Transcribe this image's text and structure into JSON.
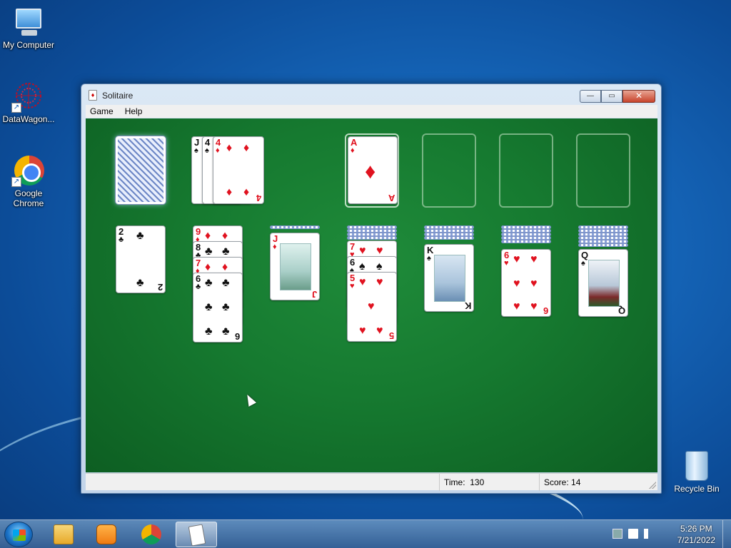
{
  "desktop": {
    "icons": [
      {
        "label": "My Computer",
        "icon": "computer-icon"
      },
      {
        "label": "DataWagon...",
        "icon": "datawagon-icon"
      },
      {
        "label": "Google Chrome",
        "icon": "chrome-icon"
      }
    ],
    "recycle_bin": {
      "label": "Recycle Bin",
      "icon": "recycle-bin-icon"
    }
  },
  "window": {
    "title": "Solitaire",
    "menu": [
      "Game",
      "Help"
    ],
    "controls": {
      "minimize": "—",
      "maximize": "▭",
      "close": "✕"
    }
  },
  "game": {
    "stock": {
      "face_down": true
    },
    "waste": [
      {
        "rank": "J",
        "suit": "♠"
      },
      {
        "rank": "4",
        "suit": "♠"
      },
      {
        "rank": "4",
        "suit": "♦"
      }
    ],
    "foundations": [
      {
        "rank": "A",
        "suit": "♦"
      },
      null,
      null,
      null
    ],
    "tableau": [
      {
        "hidden": 0,
        "cards": [
          {
            "rank": "2",
            "suit": "♣"
          }
        ]
      },
      {
        "hidden": 0,
        "cards": [
          {
            "rank": "9",
            "suit": "♦"
          },
          {
            "rank": "8",
            "suit": "♣"
          },
          {
            "rank": "7",
            "suit": "♦"
          },
          {
            "rank": "6",
            "suit": "♣"
          }
        ]
      },
      {
        "hidden": 1,
        "cards": [
          {
            "rank": "J",
            "suit": "♦"
          }
        ]
      },
      {
        "hidden": 4,
        "cards": [
          {
            "rank": "7",
            "suit": "♥"
          },
          {
            "rank": "6",
            "suit": "♠"
          },
          {
            "rank": "5",
            "suit": "♥"
          }
        ]
      },
      {
        "hidden": 4,
        "cards": [
          {
            "rank": "K",
            "suit": "♠"
          }
        ]
      },
      {
        "hidden": 5,
        "cards": [
          {
            "rank": "6",
            "suit": "♥"
          }
        ]
      },
      {
        "hidden": 6,
        "cards": [
          {
            "rank": "Q",
            "suit": "♠"
          }
        ]
      }
    ]
  },
  "status": {
    "time_label": "Time:",
    "time_value": "130",
    "score_label": "Score:",
    "score_value": "14"
  },
  "taskbar": {
    "items": [
      "explorer-icon",
      "media-player-icon",
      "chrome-icon",
      "solitaire-icon"
    ],
    "clock_time": "5:26 PM",
    "clock_date": "7/21/2022"
  }
}
